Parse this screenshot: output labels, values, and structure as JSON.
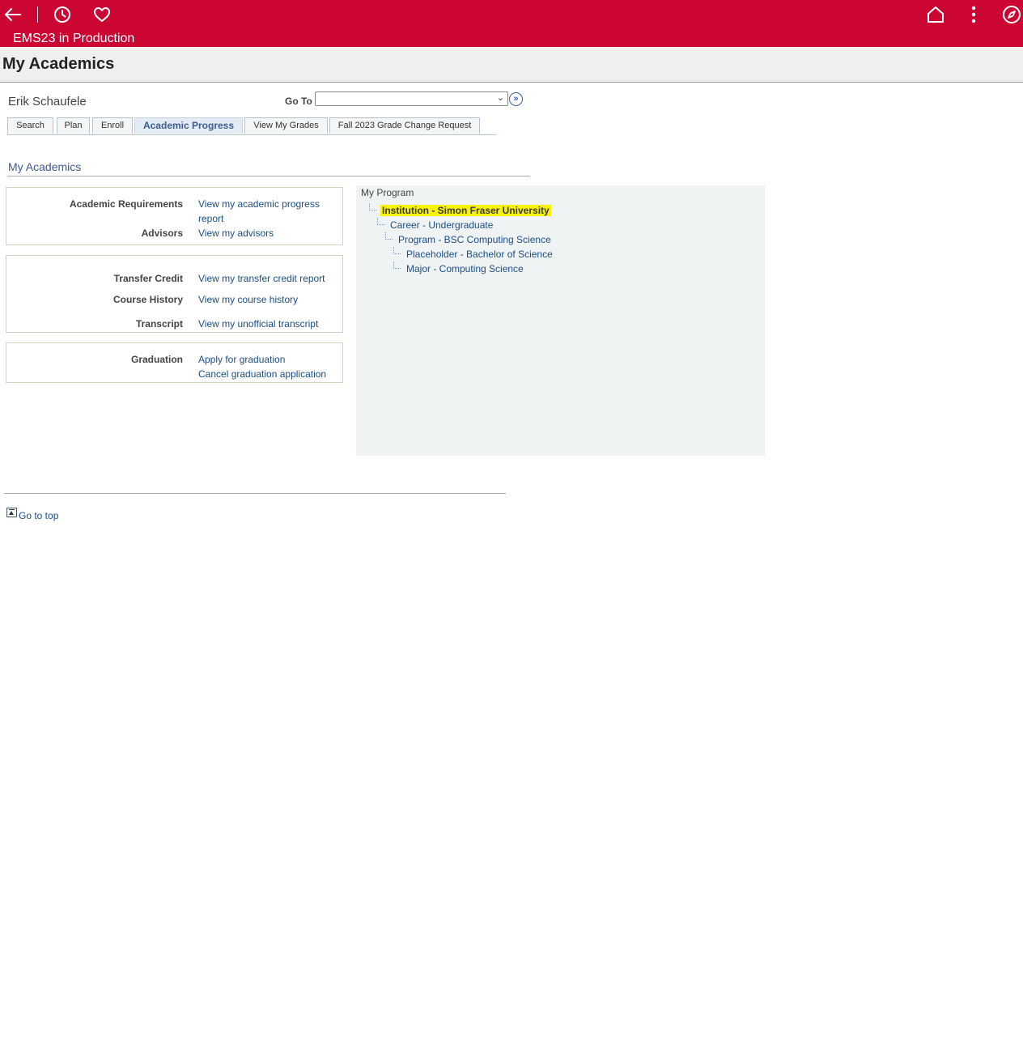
{
  "app": {
    "title": "EMS23 in Production"
  },
  "header": {
    "page_title": "My Academics"
  },
  "student": {
    "name": "Erik Schaufele"
  },
  "goto": {
    "label": "Go To",
    "selected": ""
  },
  "tabs": [
    {
      "label": "Search"
    },
    {
      "label": "Plan"
    },
    {
      "label": "Enroll"
    },
    {
      "label": "Academic Progress",
      "active": true
    },
    {
      "label": "View My Grades"
    },
    {
      "label": "Fall 2023 Grade Change Request"
    }
  ],
  "section": {
    "title": "My Academics"
  },
  "boxes": {
    "requirements": {
      "label": "Academic Requirements",
      "link_line1": "View my academic progress",
      "link_line2": "report"
    },
    "advisors": {
      "label": "Advisors",
      "link": "View my advisors"
    },
    "transfer": {
      "label": "Transfer Credit",
      "link": "View my transfer credit report"
    },
    "history": {
      "label": "Course History",
      "link": "View my course history"
    },
    "transcript": {
      "label": "Transcript",
      "link": "View my unofficial transcript"
    },
    "graduation": {
      "label": "Graduation",
      "link_apply": "Apply for graduation",
      "link_cancel": "Cancel graduation application"
    }
  },
  "program": {
    "title": "My Program",
    "tree": [
      "Institution - Simon Fraser University",
      "Career - Undergraduate",
      "Program - BSC Computing Science",
      "Placeholder - Bachelor of Science",
      "Major - Computing Science"
    ]
  },
  "footer": {
    "goto_top": "Go to top"
  },
  "colors": {
    "brand": "#cc0633",
    "link": "#1b4e85",
    "highlight": "#f7f20a"
  }
}
